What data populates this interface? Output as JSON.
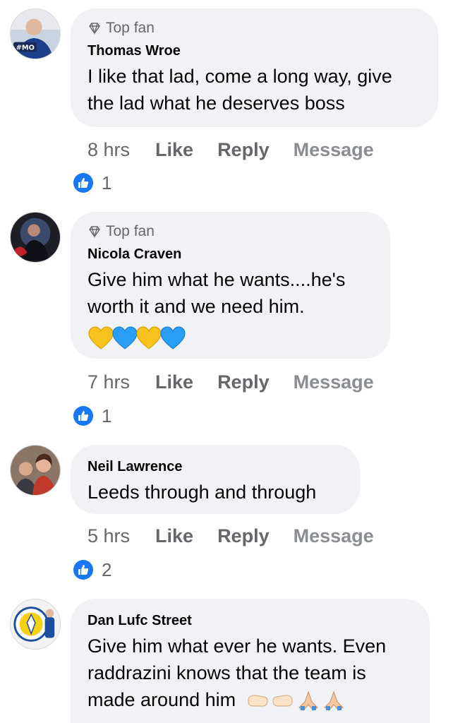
{
  "comments": [
    {
      "badge": "Top fan",
      "author": "Thomas Wroe",
      "text_lines": [
        "I like that lad, come a long way, give",
        "the lad what he deserves boss"
      ],
      "time": "8 hrs",
      "like_label": "Like",
      "reply_label": "Reply",
      "message_label": "Message",
      "reaction_count": "1"
    },
    {
      "badge": "Top fan",
      "author": "Nicola Craven",
      "text_lines": [
        "Give him what he wants....he's",
        "worth it and we need him."
      ],
      "emojis": [
        "yellow-heart",
        "blue-heart",
        "yellow-heart",
        "blue-heart"
      ],
      "time": "7 hrs",
      "like_label": "Like",
      "reply_label": "Reply",
      "message_label": "Message",
      "reaction_count": "1"
    },
    {
      "author": "Neil Lawrence",
      "text_lines": [
        "Leeds through and through"
      ],
      "time": "5 hrs",
      "like_label": "Like",
      "reply_label": "Reply",
      "message_label": "Message",
      "reaction_count": "2"
    },
    {
      "author": "Dan Lufc Street",
      "text_lines": [
        "Give him what ever he wants. Even",
        "raddrazini knows that the team is",
        "made around him"
      ],
      "trailing_emojis": [
        "fist-bump",
        "fist-bump",
        "praying-hands",
        "praying-hands"
      ]
    }
  ],
  "colors": {
    "bubble": "#f0f2f5",
    "secondary_text": "#65676b",
    "like_blue": "#1877f2",
    "yellow_heart": "#f7c21b",
    "blue_heart": "#2a9df4"
  }
}
